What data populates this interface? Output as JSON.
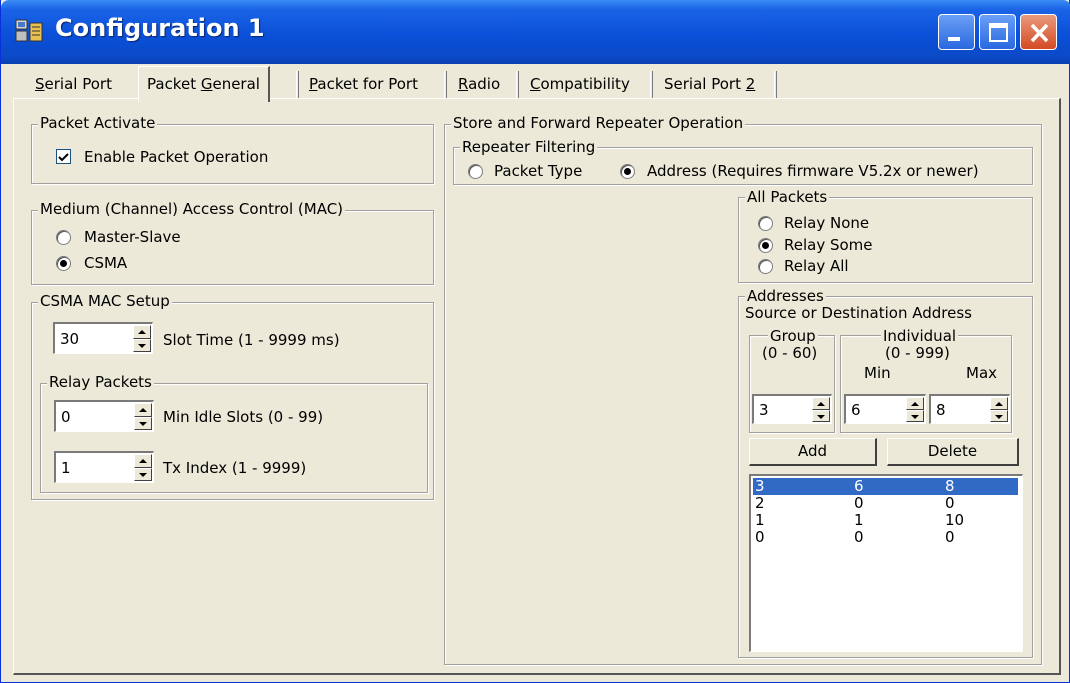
{
  "window": {
    "title": "Configuration 1"
  },
  "tabs": [
    {
      "label_pre": "",
      "label_u": "S",
      "label_post": "erial Port"
    },
    {
      "label_pre": "Packet ",
      "label_u": "G",
      "label_post": "eneral"
    },
    {
      "label_pre": "",
      "label_u": "P",
      "label_post": "acket for Port"
    },
    {
      "label_pre": "",
      "label_u": "R",
      "label_post": "adio"
    },
    {
      "label_pre": "",
      "label_u": "C",
      "label_post": "ompatibility"
    },
    {
      "label_pre": "Serial Port ",
      "label_u": "2",
      "label_post": ""
    }
  ],
  "packet_activate": {
    "legend": "Packet Activate",
    "enable_label": "Enable Packet Operation",
    "enable_checked": true
  },
  "mac": {
    "legend": "Medium (Channel) Access Control (MAC)",
    "options": [
      "Master-Slave",
      "CSMA"
    ],
    "selected": "CSMA"
  },
  "csma_setup": {
    "legend": "CSMA MAC Setup",
    "slot_time_value": "30",
    "slot_time_label": "Slot Time (1 - 9999 ms)",
    "relay_packets": {
      "legend": "Relay Packets",
      "min_idle_value": "0",
      "min_idle_label": "Min Idle Slots  (0 - 99)",
      "tx_index_value": "1",
      "tx_index_label": "Tx Index  (1 - 9999)"
    }
  },
  "store_forward": {
    "legend": "Store and Forward Repeater Operation",
    "repeater_filtering": {
      "legend": "Repeater Filtering",
      "options": [
        "Packet Type",
        "Address (Requires firmware V5.2x or newer)"
      ],
      "selected": "Address (Requires firmware V5.2x or newer)"
    },
    "all_packets": {
      "legend": "All Packets",
      "options": [
        "Relay None",
        "Relay Some",
        "Relay All"
      ],
      "selected": "Relay Some"
    },
    "addresses": {
      "legend": "Addresses",
      "caption": "Source or Destination Address",
      "group": {
        "legend": "Group",
        "range": "(0 - 60)",
        "value": "3"
      },
      "individual": {
        "legend": "Individual",
        "range": "(0 - 999)",
        "min_label": "Min",
        "max_label": "Max",
        "min_value": "6",
        "max_value": "8"
      },
      "add_label": "Add",
      "delete_label": "Delete",
      "rows": [
        [
          "3",
          "6",
          "8"
        ],
        [
          "2",
          "0",
          "0"
        ],
        [
          "1",
          "1",
          "10"
        ],
        [
          "0",
          "0",
          "0"
        ]
      ],
      "selected_row": 0
    }
  },
  "colors": {
    "titlebar": "#0a50d8",
    "face": "#ece9d8",
    "selection": "#316ac5"
  }
}
